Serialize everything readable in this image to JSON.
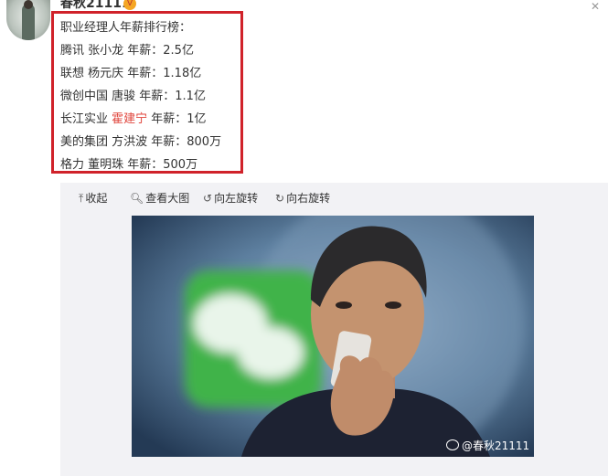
{
  "post": {
    "username": "春秋21111",
    "vip_badge": "V",
    "close_glyph": "✕",
    "lines": [
      {
        "text": "职业经理人年薪排行榜："
      },
      {
        "text": "腾讯 张小龙 年薪：2.5亿"
      },
      {
        "text": "联想 杨元庆 年薪：1.18亿"
      },
      {
        "text": "微创中国 唐骏 年薪：1.1亿"
      },
      {
        "prefix": "长江实业 ",
        "highlight": "霍建宁",
        "suffix": " 年薪：1亿"
      },
      {
        "text": "美的集团 方洪波 年薪：800万"
      },
      {
        "text": "格力 董明珠 年薪：500万"
      }
    ],
    "highlight_color": "#e0453c",
    "box_border_color": "#d0222a"
  },
  "toolbar": {
    "collapse": {
      "icon": "⤒",
      "label": "收起"
    },
    "view_large": {
      "icon": "🔍︎",
      "label": "查看大图"
    },
    "rotate_left": {
      "icon": "↺",
      "label": "向左旋转"
    },
    "rotate_right": {
      "icon": "↻",
      "label": "向右旋转"
    }
  },
  "image": {
    "watermark": "@春秋21111",
    "watermark_icon": "weibo-icon"
  }
}
